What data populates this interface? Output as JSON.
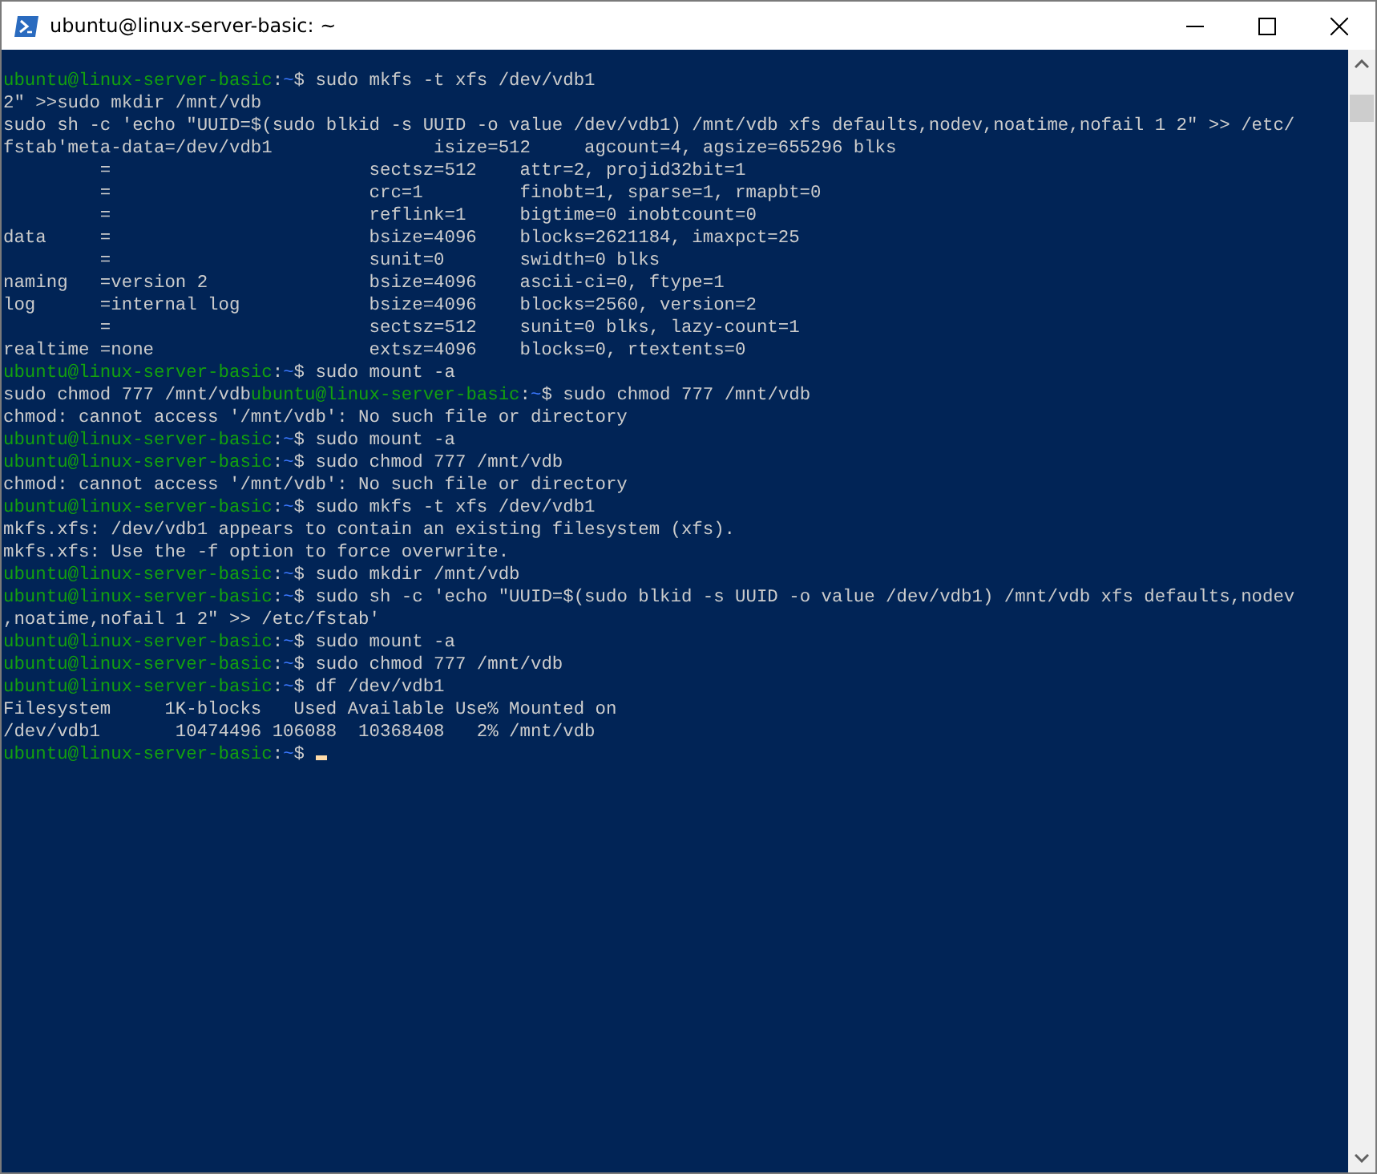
{
  "window": {
    "title": "ubuntu@linux-server-basic: ~"
  },
  "terminal": {
    "lines": [
      {
        "segments": [
          {
            "kind": "user",
            "text": "ubuntu@linux-server-basic"
          },
          {
            "kind": "plain",
            "text": ":"
          },
          {
            "kind": "path",
            "text": "~"
          },
          {
            "kind": "plain",
            "text": "$ sudo mkfs -t xfs /dev/vdb1"
          }
        ]
      },
      {
        "segments": [
          {
            "kind": "plain",
            "text": "2\" >>sudo mkdir /mnt/vdb"
          }
        ]
      },
      {
        "segments": [
          {
            "kind": "plain",
            "text": "sudo sh -c 'echo \"UUID=$(sudo blkid -s UUID -o value /dev/vdb1) /mnt/vdb xfs defaults,nodev,noatime,nofail 1 2\" >> /etc/"
          }
        ]
      },
      {
        "segments": [
          {
            "kind": "plain",
            "text": "fstab'meta-data=/dev/vdb1               isize=512     agcount=4, agsize=655296 blks"
          }
        ]
      },
      {
        "segments": [
          {
            "kind": "plain",
            "text": "         =                        sectsz=512    attr=2, projid32bit=1"
          }
        ]
      },
      {
        "segments": [
          {
            "kind": "plain",
            "text": "         =                        crc=1         finobt=1, sparse=1, rmapbt=0"
          }
        ]
      },
      {
        "segments": [
          {
            "kind": "plain",
            "text": "         =                        reflink=1     bigtime=0 inobtcount=0"
          }
        ]
      },
      {
        "segments": [
          {
            "kind": "plain",
            "text": "data     =                        bsize=4096    blocks=2621184, imaxpct=25"
          }
        ]
      },
      {
        "segments": [
          {
            "kind": "plain",
            "text": "         =                        sunit=0       swidth=0 blks"
          }
        ]
      },
      {
        "segments": [
          {
            "kind": "plain",
            "text": "naming   =version 2               bsize=4096    ascii-ci=0, ftype=1"
          }
        ]
      },
      {
        "segments": [
          {
            "kind": "plain",
            "text": "log      =internal log            bsize=4096    blocks=2560, version=2"
          }
        ]
      },
      {
        "segments": [
          {
            "kind": "plain",
            "text": "         =                        sectsz=512    sunit=0 blks, lazy-count=1"
          }
        ]
      },
      {
        "segments": [
          {
            "kind": "plain",
            "text": "realtime =none                    extsz=4096    blocks=0, rtextents=0"
          }
        ]
      },
      {
        "segments": [
          {
            "kind": "user",
            "text": "ubuntu@linux-server-basic"
          },
          {
            "kind": "plain",
            "text": ":"
          },
          {
            "kind": "path",
            "text": "~"
          },
          {
            "kind": "plain",
            "text": "$ sudo mount -a"
          }
        ]
      },
      {
        "segments": [
          {
            "kind": "plain",
            "text": "sudo chmod 777 /mnt/vdb"
          },
          {
            "kind": "user",
            "text": "ubuntu@linux-server-basic"
          },
          {
            "kind": "plain",
            "text": ":"
          },
          {
            "kind": "path",
            "text": "~"
          },
          {
            "kind": "plain",
            "text": "$ sudo chmod 777 /mnt/vdb"
          }
        ]
      },
      {
        "segments": [
          {
            "kind": "plain",
            "text": "chmod: cannot access '/mnt/vdb': No such file or directory"
          }
        ]
      },
      {
        "segments": [
          {
            "kind": "user",
            "text": "ubuntu@linux-server-basic"
          },
          {
            "kind": "plain",
            "text": ":"
          },
          {
            "kind": "path",
            "text": "~"
          },
          {
            "kind": "plain",
            "text": "$ sudo mount -a"
          }
        ]
      },
      {
        "segments": [
          {
            "kind": "user",
            "text": "ubuntu@linux-server-basic"
          },
          {
            "kind": "plain",
            "text": ":"
          },
          {
            "kind": "path",
            "text": "~"
          },
          {
            "kind": "plain",
            "text": "$ sudo chmod 777 /mnt/vdb"
          }
        ]
      },
      {
        "segments": [
          {
            "kind": "plain",
            "text": "chmod: cannot access '/mnt/vdb': No such file or directory"
          }
        ]
      },
      {
        "segments": [
          {
            "kind": "user",
            "text": "ubuntu@linux-server-basic"
          },
          {
            "kind": "plain",
            "text": ":"
          },
          {
            "kind": "path",
            "text": "~"
          },
          {
            "kind": "plain",
            "text": "$ sudo mkfs -t xfs /dev/vdb1"
          }
        ]
      },
      {
        "segments": [
          {
            "kind": "plain",
            "text": "mkfs.xfs: /dev/vdb1 appears to contain an existing filesystem (xfs)."
          }
        ]
      },
      {
        "segments": [
          {
            "kind": "plain",
            "text": "mkfs.xfs: Use the -f option to force overwrite."
          }
        ]
      },
      {
        "segments": [
          {
            "kind": "user",
            "text": "ubuntu@linux-server-basic"
          },
          {
            "kind": "plain",
            "text": ":"
          },
          {
            "kind": "path",
            "text": "~"
          },
          {
            "kind": "plain",
            "text": "$ sudo mkdir /mnt/vdb"
          }
        ]
      },
      {
        "segments": [
          {
            "kind": "user",
            "text": "ubuntu@linux-server-basic"
          },
          {
            "kind": "plain",
            "text": ":"
          },
          {
            "kind": "path",
            "text": "~"
          },
          {
            "kind": "plain",
            "text": "$ sudo sh -c 'echo \"UUID=$(sudo blkid -s UUID -o value /dev/vdb1) /mnt/vdb xfs defaults,nodev"
          }
        ]
      },
      {
        "segments": [
          {
            "kind": "plain",
            "text": ",noatime,nofail 1 2\" >> /etc/fstab'"
          }
        ]
      },
      {
        "segments": [
          {
            "kind": "user",
            "text": "ubuntu@linux-server-basic"
          },
          {
            "kind": "plain",
            "text": ":"
          },
          {
            "kind": "path",
            "text": "~"
          },
          {
            "kind": "plain",
            "text": "$ sudo mount -a"
          }
        ]
      },
      {
        "segments": [
          {
            "kind": "user",
            "text": "ubuntu@linux-server-basic"
          },
          {
            "kind": "plain",
            "text": ":"
          },
          {
            "kind": "path",
            "text": "~"
          },
          {
            "kind": "plain",
            "text": "$ sudo chmod 777 /mnt/vdb"
          }
        ]
      },
      {
        "segments": [
          {
            "kind": "user",
            "text": "ubuntu@linux-server-basic"
          },
          {
            "kind": "plain",
            "text": ":"
          },
          {
            "kind": "path",
            "text": "~"
          },
          {
            "kind": "plain",
            "text": "$ df /dev/vdb1"
          }
        ]
      },
      {
        "segments": [
          {
            "kind": "plain",
            "text": "Filesystem     1K-blocks   Used Available Use% Mounted on"
          }
        ]
      },
      {
        "segments": [
          {
            "kind": "plain",
            "text": "/dev/vdb1       10474496 106088  10368408   2% /mnt/vdb"
          }
        ]
      },
      {
        "segments": [
          {
            "kind": "user",
            "text": "ubuntu@linux-server-basic"
          },
          {
            "kind": "plain",
            "text": ":"
          },
          {
            "kind": "path",
            "text": "~"
          },
          {
            "kind": "plain",
            "text": "$ "
          }
        ],
        "cursor": true
      }
    ]
  }
}
